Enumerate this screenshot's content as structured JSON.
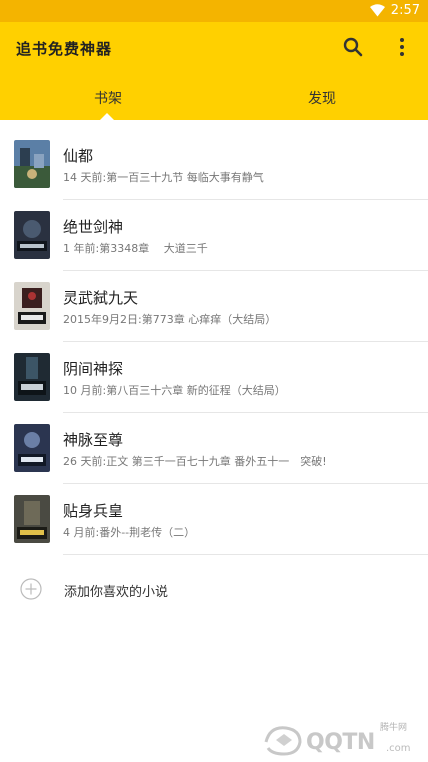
{
  "status_bar": {
    "time": "2:57"
  },
  "app_bar": {
    "title": "追书免费神器",
    "tabs": [
      {
        "label": "书架",
        "selected": true
      },
      {
        "label": "发现",
        "selected": false
      }
    ]
  },
  "books": [
    {
      "title": "仙都",
      "subtitle": "14 天前:第一百三十九节 每临大事有静气",
      "cover_color": "#5b7fa6"
    },
    {
      "title": "绝世剑神",
      "subtitle": "1 年前:第3348章　 大道三千",
      "cover_color": "#2a3140"
    },
    {
      "title": "灵武弑九天",
      "subtitle": "2015年9月2日:第773章 心痒痒（大结局）",
      "cover_color": "#3b1f1f"
    },
    {
      "title": "阴间神探",
      "subtitle": "10 月前:第八百三十六章 新的征程（大结局）",
      "cover_color": "#1f2a33"
    },
    {
      "title": "神脉至尊",
      "subtitle": "26 天前:正文 第三千一百七十九章 番外五十一　突破!",
      "cover_color": "#2b3550"
    },
    {
      "title": "贴身兵皇",
      "subtitle": "4 月前:番外--荆老传（二）",
      "cover_color": "#4a4a42"
    }
  ],
  "add_book": {
    "label": "添加你喜欢的小说"
  },
  "watermark": {
    "brand": "QQTN",
    "small": "腾牛网",
    "suffix": ".com"
  },
  "colors": {
    "status_bar": "#f4b400",
    "app_bar": "#ffd000"
  }
}
